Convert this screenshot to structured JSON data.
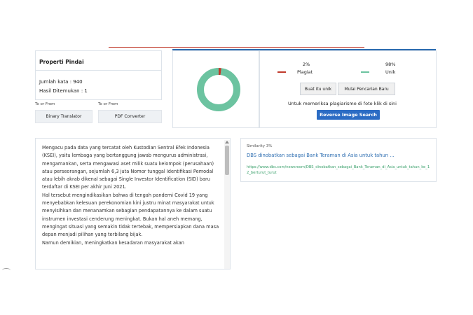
{
  "properties": {
    "title": "Properti Pindai",
    "word_count": "Jumlah kata : 940",
    "results_found": "Hasil Ditemukan : 1"
  },
  "tools": [
    {
      "caption": "To or From",
      "label": "Binary Translator"
    },
    {
      "caption": "To or From",
      "label": "PDF Converter"
    }
  ],
  "result": {
    "plagiarism_percent": "2%",
    "plagiarism_label": "Plagiat",
    "unique_percent": "98%",
    "unique_label": "Unik",
    "plagiarism_value": 2,
    "plagiarism_color": "#c0392b",
    "unique_color": "#6cc3a0",
    "make_unique_label": "Buat itu unik",
    "new_search_label": "Mulai Pencarian Baru",
    "image_prompt": "Untuk memeriksa plagiarisme di foto klik di sini",
    "reverse_search_label": "Reverse Image Search"
  },
  "article": {
    "paragraphs": [
      "Mengacu pada data yang tercatat oleh Kustodian Sentral Efek Indonesia (KSEI), yaitu lembaga yang bertanggung jawab mengurus administrasi, mengamankan, serta mengawasi aset milik suatu kelompok (perusahaan) atau perseorangan, sejumlah 6,3 juta Nomor tunggal Identifikasi Pemodal atau lebih akrab dikenal sebagai Single Investor Identification (SID) baru terdaftar di KSEI per akhir Juni 2021.",
      "Hal tersebut mengindikasikan bahwa di tengah pandemi Covid 19 yang menyebabkan kelesuan perekonomian kini justru minat masyarakat untuk menyisihkan dan menanamkan sebagian pendapatannya ke dalam suatu instrumen investasi cenderung meningkat. Bukan hal aneh memang, mengingat situasi yang semakin tidak tertebak, mempersiapkan dana masa depan menjadi pilihan yang terbilang bijak.",
      "Namun demikian, meningkatkan kesadaran masyarakat akan"
    ]
  },
  "match": {
    "similarity": "Similarity 3%",
    "title": "DBS dinobatkan sebagai Bank Teraman di Asia untuk tahun ...",
    "url": "https://www.dbs.com/newsroom/DBS_dinobatkan_sebagai_Bank_Teraman_di_Asia_untuk_tahun_ke_12_berturut_turut"
  }
}
